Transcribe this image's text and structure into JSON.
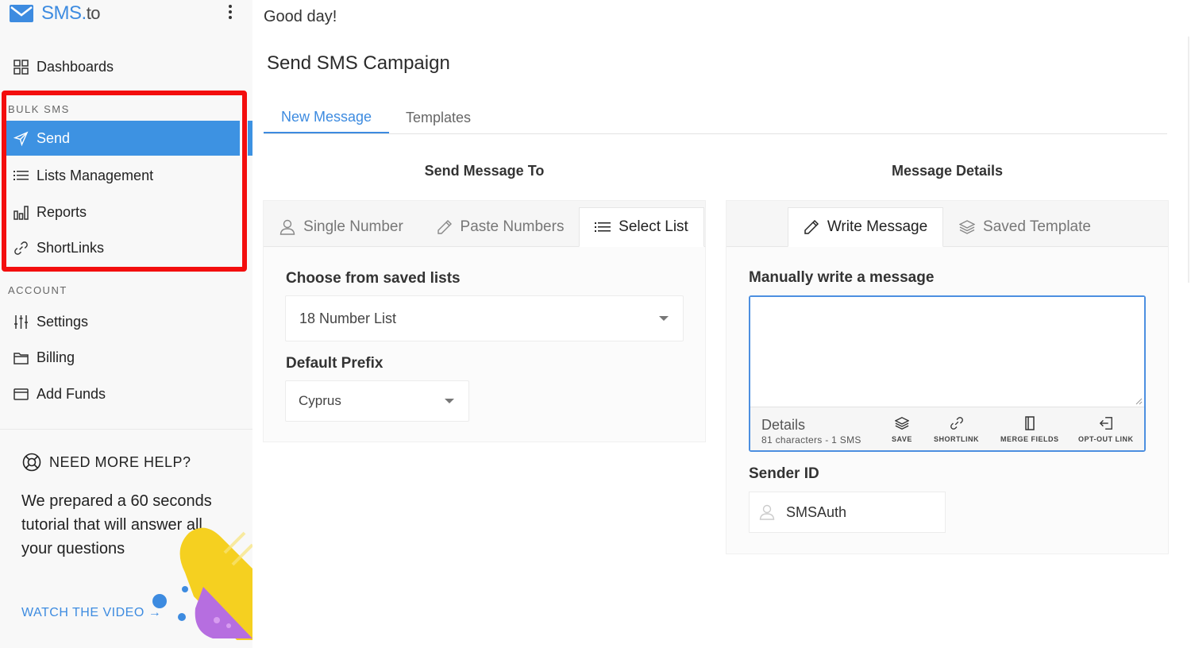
{
  "sidebar": {
    "brand": {
      "name": "SMS",
      "dot": ".",
      "tld": "to",
      "color": "#3d8be0"
    },
    "dashboards_label": "Dashboards",
    "bulk_sms_label": "BULK SMS",
    "bulk_items": [
      {
        "label": "Send",
        "icon": "send-icon",
        "active": true
      },
      {
        "label": "Lists Management",
        "icon": "list-icon"
      },
      {
        "label": "Reports",
        "icon": "bar-chart-icon"
      },
      {
        "label": "ShortLinks",
        "icon": "link-icon"
      }
    ],
    "account_label": "ACCOUNT",
    "account_items": [
      {
        "label": "Settings",
        "icon": "sliders-icon"
      },
      {
        "label": "Billing",
        "icon": "folder-icon"
      },
      {
        "label": "Add Funds",
        "icon": "credit-card-icon"
      }
    ],
    "help": {
      "title": "NEED MORE HELP?",
      "text": "We prepared a 60 seconds tutorial that will answer all your questions",
      "link": "WATCH THE VIDEO →"
    },
    "highlight_color": "#f30e0e",
    "active_color": "#3d92e2"
  },
  "main": {
    "greeting": "Good day!",
    "title": "Send SMS Campaign",
    "tabs": [
      {
        "label": "New Message",
        "active": true
      },
      {
        "label": "Templates",
        "active": false
      }
    ],
    "left": {
      "heading": "Send Message To",
      "tabs": [
        {
          "label": "Single Number",
          "icon": "user-icon"
        },
        {
          "label": "Paste Numbers",
          "icon": "pencil-icon"
        },
        {
          "label": "Select List",
          "icon": "list-icon",
          "selected": true
        }
      ],
      "saved_lists_label": "Choose from saved lists",
      "saved_list_value": "18 Number List",
      "prefix_label": "Default Prefix",
      "prefix_value": "Cyprus"
    },
    "right": {
      "heading": "Message Details",
      "tabs": [
        {
          "label": "Write Message",
          "icon": "pencil-icon",
          "selected": true
        },
        {
          "label": "Saved Template",
          "icon": "layers-icon"
        }
      ],
      "write_label": "Manually write a message",
      "message_value": "",
      "details_title": "Details",
      "details_sub": "81 characters - 1 SMS",
      "tools": [
        {
          "label": "SAVE",
          "icon": "layers-icon"
        },
        {
          "label": "SHORTLINK",
          "icon": "link-icon"
        },
        {
          "label": "MERGE FIELDS",
          "icon": "bracket-icon"
        },
        {
          "label": "OPT-OUT LINK",
          "icon": "exit-icon"
        }
      ],
      "sender_label": "Sender ID",
      "sender_value": "SMSAuth"
    }
  }
}
